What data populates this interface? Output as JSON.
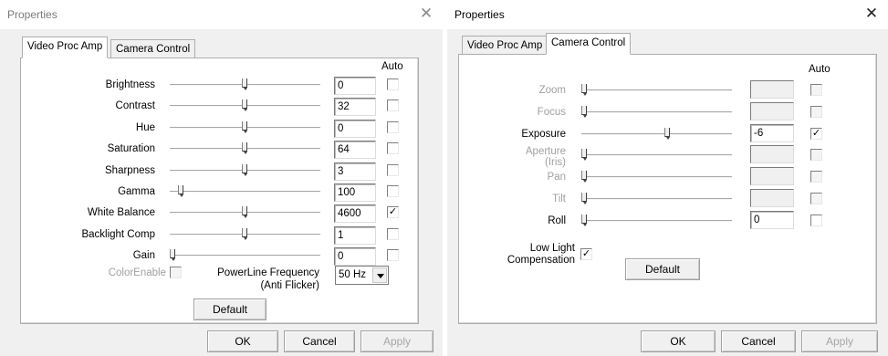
{
  "left_dialog": {
    "title": "Properties",
    "close": "✕",
    "tabs": [
      "Video Proc Amp",
      "Camera Control"
    ],
    "auto_header": "Auto",
    "rows": [
      {
        "label": "Brightness",
        "value": "0",
        "slider": 0.5,
        "auto": false
      },
      {
        "label": "Contrast",
        "value": "32",
        "slider": 0.5,
        "auto": false
      },
      {
        "label": "Hue",
        "value": "0",
        "slider": 0.5,
        "auto": false
      },
      {
        "label": "Saturation",
        "value": "64",
        "slider": 0.5,
        "auto": false
      },
      {
        "label": "Sharpness",
        "value": "3",
        "slider": 0.5,
        "auto": false
      },
      {
        "label": "Gamma",
        "value": "100",
        "slider": 0.06,
        "auto": false
      },
      {
        "label": "White Balance",
        "value": "4600",
        "slider": 0.5,
        "auto": true
      },
      {
        "label": "Backlight Comp",
        "value": "1",
        "slider": 0.5,
        "auto": false
      },
      {
        "label": "Gain",
        "value": "0",
        "slider": 0.0,
        "auto": false
      }
    ],
    "color_enable_label": "ColorEnable",
    "powerline_label": "PowerLine Frequency",
    "powerline_sub": "(Anti Flicker)",
    "powerline_value": "50 Hz",
    "default_button": "Default",
    "ok": "OK",
    "cancel": "Cancel",
    "apply": "Apply"
  },
  "right_dialog": {
    "title": "Properties",
    "close": "✕",
    "tabs": [
      "Video Proc Amp",
      "Camera Control"
    ],
    "auto_header": "Auto",
    "rows": [
      {
        "label": "Zoom",
        "value": "",
        "slider": 0.0,
        "auto": false,
        "enabled": false
      },
      {
        "label": "Focus",
        "value": "",
        "slider": 0.0,
        "auto": false,
        "enabled": false
      },
      {
        "label": "Exposure",
        "value": "-6",
        "slider": 0.58,
        "auto": true,
        "enabled": true
      },
      {
        "label": "Aperture",
        "label2": "(Iris)",
        "value": "",
        "slider": 0.0,
        "auto": false,
        "enabled": false
      },
      {
        "label": "Pan",
        "value": "",
        "slider": 0.0,
        "auto": false,
        "enabled": false
      },
      {
        "label": "Tilt",
        "value": "",
        "slider": 0.0,
        "auto": false,
        "enabled": false
      },
      {
        "label": "Roll",
        "value": "0",
        "slider": 0.0,
        "auto": false,
        "enabled": true
      }
    ],
    "low_light_label_1": "Low Light",
    "low_light_label_2": "Compensation",
    "low_light_checked": true,
    "default_button": "Default",
    "ok": "OK",
    "cancel": "Cancel",
    "apply": "Apply"
  }
}
